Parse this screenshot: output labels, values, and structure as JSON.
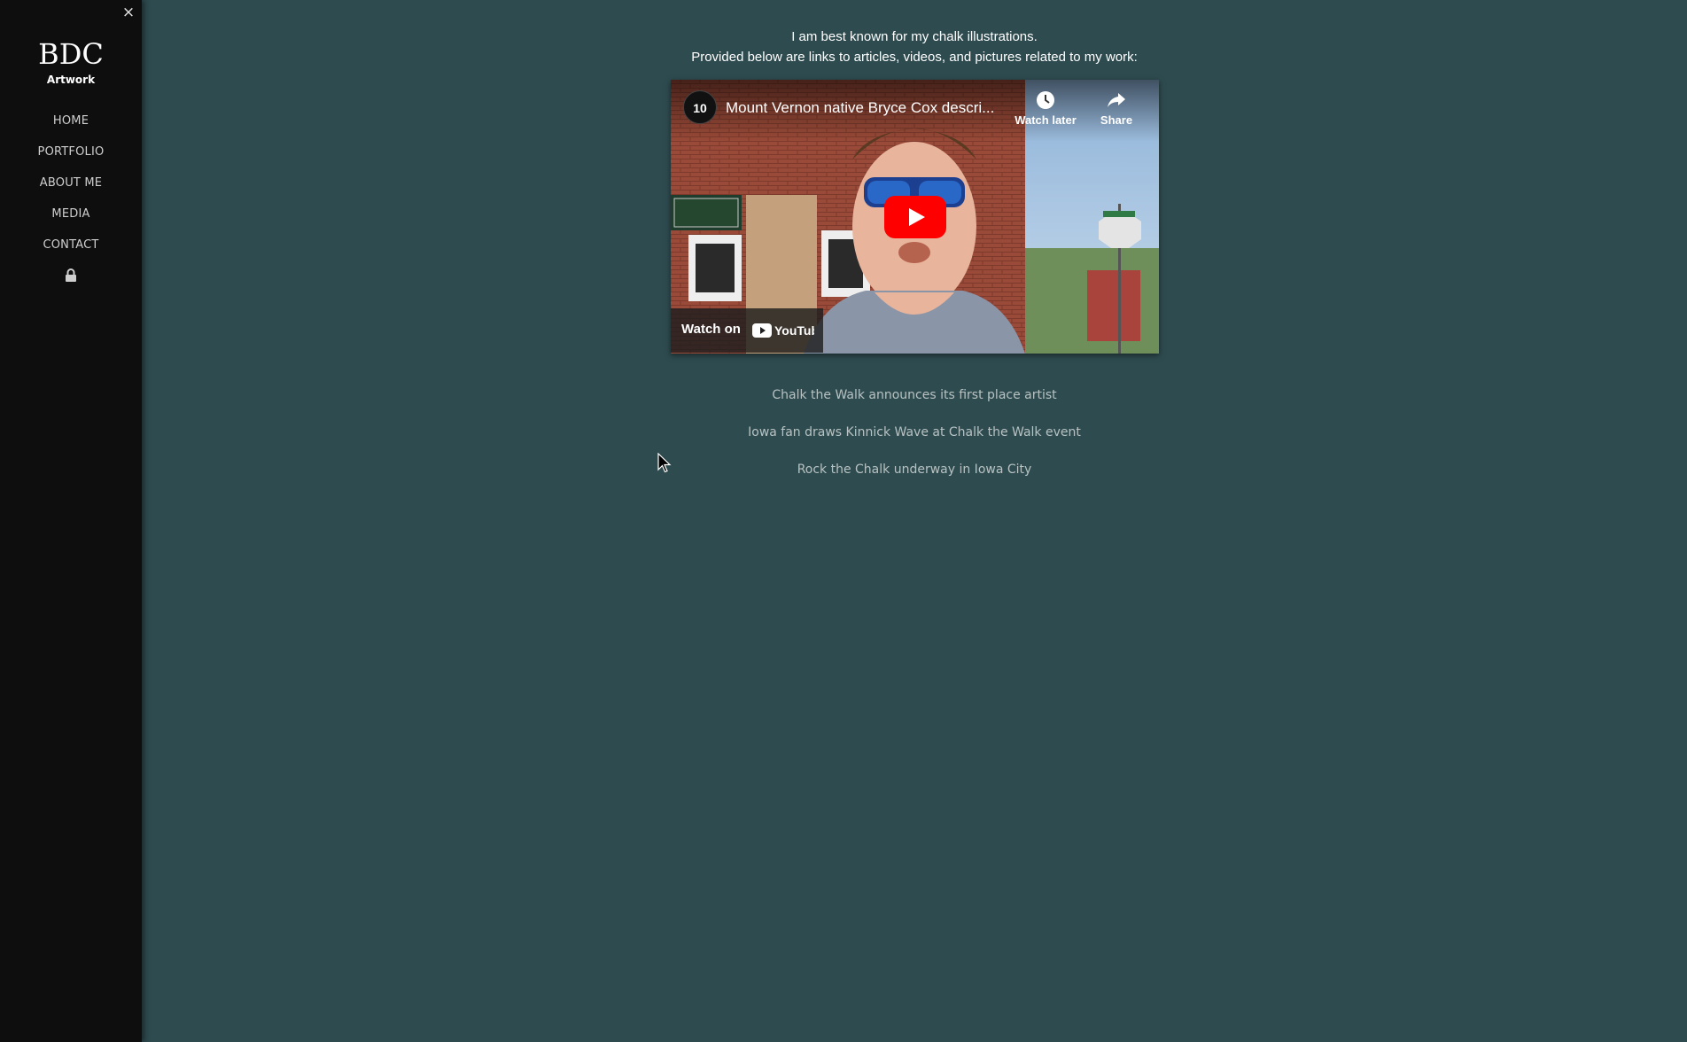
{
  "sidebar": {
    "close_symbol": "×",
    "brand_title": "BDC",
    "brand_subtitle": "Artwork",
    "nav": [
      "HOME",
      "PORTFOLIO",
      "ABOUT ME",
      "MEDIA",
      "CONTACT"
    ],
    "lock_icon": "lock-icon"
  },
  "main": {
    "intro_line1": "I am best known for my chalk illustrations.",
    "intro_line2": "Provided below are links to articles, videos, and pictures related to my work:",
    "video": {
      "channel_logo_text": "10",
      "title": "Mount Vernon native Bryce Cox descri...",
      "watch_later": "Watch later",
      "share": "Share",
      "watch_on": "Watch on",
      "youtube": "YouTube"
    },
    "links": [
      "Chalk the Walk announces its first place artist",
      "Iowa fan draws Kinnick Wave at Chalk the Walk event",
      "Rock the Chalk underway in Iowa City"
    ]
  },
  "colors": {
    "page_bg": "#2e4b4f",
    "sidebar_bg": "#0e0e0e",
    "youtube_red": "#ff0000",
    "link_color": "#b8c2c2"
  }
}
